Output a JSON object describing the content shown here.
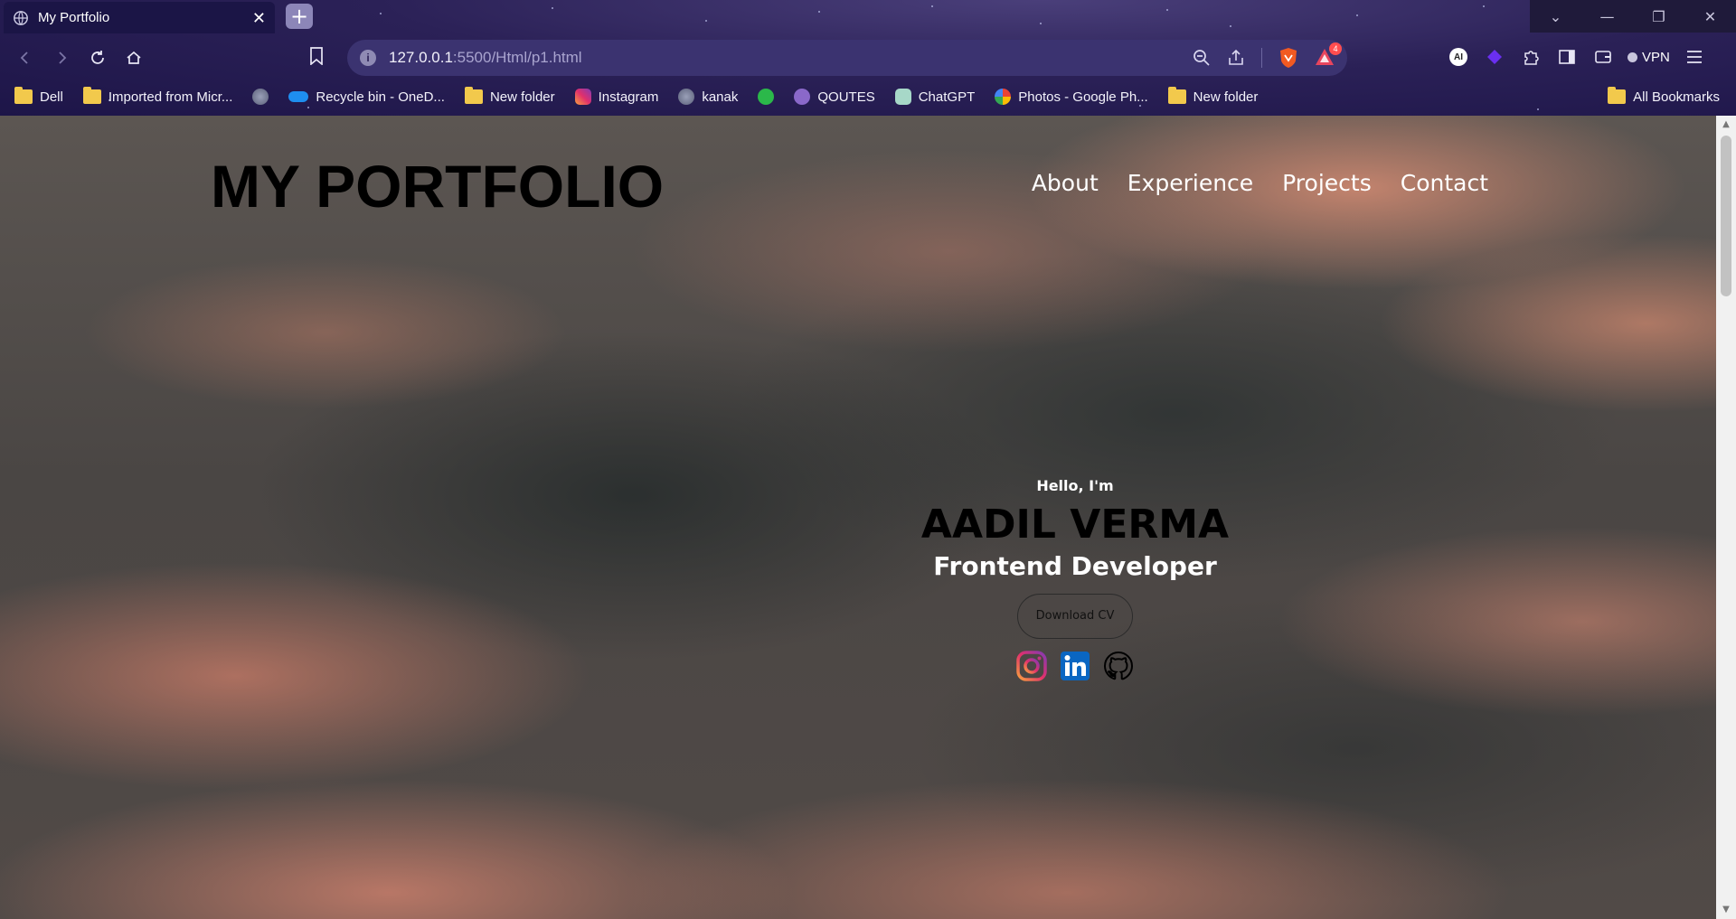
{
  "browser": {
    "tab_title": "My Portfolio",
    "url_host": "127.0.0.1",
    "url_path": ":5500/Html/p1.html",
    "notification_count": "4",
    "vpn_label": "VPN",
    "ai_label": "AI",
    "bookmarks": [
      {
        "label": "Dell",
        "icon": "folder-icon"
      },
      {
        "label": "Imported from Micr...",
        "icon": "folder-icon"
      },
      {
        "label": "",
        "icon": "globe-icon"
      },
      {
        "label": "Recycle bin - OneD...",
        "icon": "onedrive-icon"
      },
      {
        "label": "New folder",
        "icon": "folder-icon"
      },
      {
        "label": "Instagram",
        "icon": "instagram-icon"
      },
      {
        "label": "kanak",
        "icon": "globe-icon"
      },
      {
        "label": "",
        "icon": "bolt-icon"
      },
      {
        "label": "QOUTES",
        "icon": "quotes-icon"
      },
      {
        "label": "ChatGPT",
        "icon": "chatgpt-icon"
      },
      {
        "label": "Photos - Google Ph...",
        "icon": "google-photos-icon"
      },
      {
        "label": "New folder",
        "icon": "folder-icon"
      }
    ],
    "all_bookmarks": "All Bookmarks"
  },
  "site": {
    "logo": "MY PORTFOLIO",
    "nav": [
      "About",
      "Experience",
      "Projects",
      "Contact"
    ],
    "hero": {
      "greeting": "Hello, I'm",
      "name": "AADIL VERMA",
      "role": "Frontend Developer",
      "cv_button": "Download CV"
    },
    "socials": [
      "instagram-icon",
      "linkedin-icon",
      "github-icon"
    ]
  }
}
